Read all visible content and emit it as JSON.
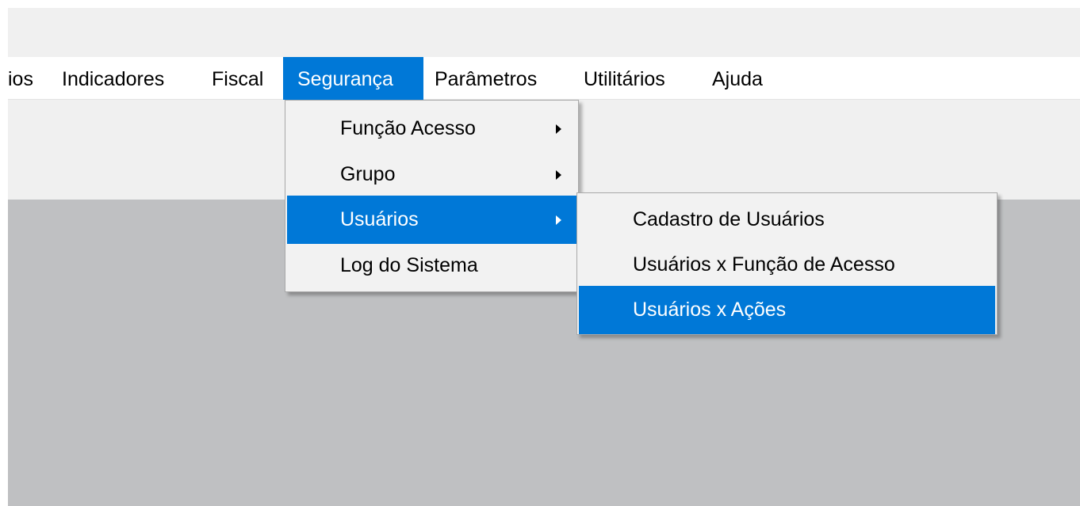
{
  "menubar": {
    "items": [
      {
        "label": "ios"
      },
      {
        "label": "Indicadores"
      },
      {
        "label": "Fiscal"
      },
      {
        "label": "Segurança"
      },
      {
        "label": "Parâmetros"
      },
      {
        "label": "Utilitários"
      },
      {
        "label": "Ajuda"
      }
    ],
    "active": "Segurança"
  },
  "seguranca_menu": {
    "items": [
      {
        "label": "Função Acesso",
        "submenu_arrow": true
      },
      {
        "label": "Grupo",
        "submenu_arrow": true
      },
      {
        "label": "Usuários",
        "submenu_arrow": true,
        "highlighted": true
      },
      {
        "label": "Log do Sistema",
        "submenu_arrow": false
      }
    ]
  },
  "usuarios_submenu": {
    "items": [
      {
        "label": "Cadastro de Usuários"
      },
      {
        "label": "Usuários x Função de Acesso"
      },
      {
        "label": "Usuários x Ações",
        "highlighted": true
      }
    ]
  },
  "colors": {
    "highlight": "#0078d7",
    "menu_background": "#f2f2f2",
    "workspace": "#bfc0c2",
    "toolbar": "#f0f0f0"
  }
}
